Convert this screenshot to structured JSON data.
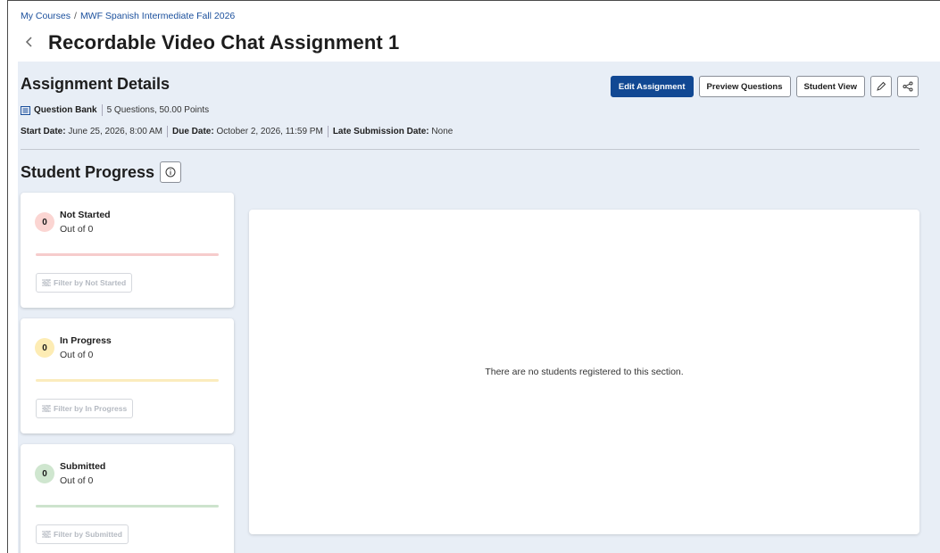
{
  "breadcrumb": {
    "items": [
      "My Courses",
      "MWF Spanish Intermediate Fall 2026"
    ],
    "separator": "/"
  },
  "page": {
    "back_icon": "chevron-left-icon",
    "title": "Recordable Video Chat Assignment 1"
  },
  "details": {
    "heading": "Assignment Details",
    "bank_icon": "question-bank-icon",
    "bank_label": "Question Bank",
    "bank_summary": "5 Questions, 50.00 Points",
    "start_label": "Start Date:",
    "start_value": "June 25, 2026, 8:00 AM",
    "due_label": "Due Date:",
    "due_value": "October 2, 2026, 11:59 PM",
    "late_label": "Late Submission Date:",
    "late_value": "None"
  },
  "toolbar": {
    "edit_label": "Edit Assignment",
    "preview_label": "Preview Questions",
    "student_view_label": "Student View",
    "edit_icon": "pencil-icon",
    "share_icon": "share-icon"
  },
  "progress": {
    "heading": "Student Progress",
    "info_icon": "info-icon",
    "cards": [
      {
        "count": "0",
        "label": "Not Started",
        "sub": "Out of 0",
        "filter": "Filter by Not Started",
        "badge_color": "#fbd5d2",
        "bar_color": "#f6cccc"
      },
      {
        "count": "0",
        "label": "In Progress",
        "sub": "Out of 0",
        "filter": "Filter by In Progress",
        "badge_color": "#fdecb4",
        "bar_color": "#fbecbd"
      },
      {
        "count": "0",
        "label": "Submitted",
        "sub": "Out of 0",
        "filter": "Filter by Submitted",
        "badge_color": "#cfe6cf",
        "bar_color": "#cde3cd"
      }
    ],
    "filter_icon": "filter-icon"
  },
  "empty_state": {
    "message": "There are no students registered to this section."
  },
  "colors": {
    "primary": "#114893",
    "panel_bg": "#e8eef6",
    "link": "#1a4f9c"
  }
}
